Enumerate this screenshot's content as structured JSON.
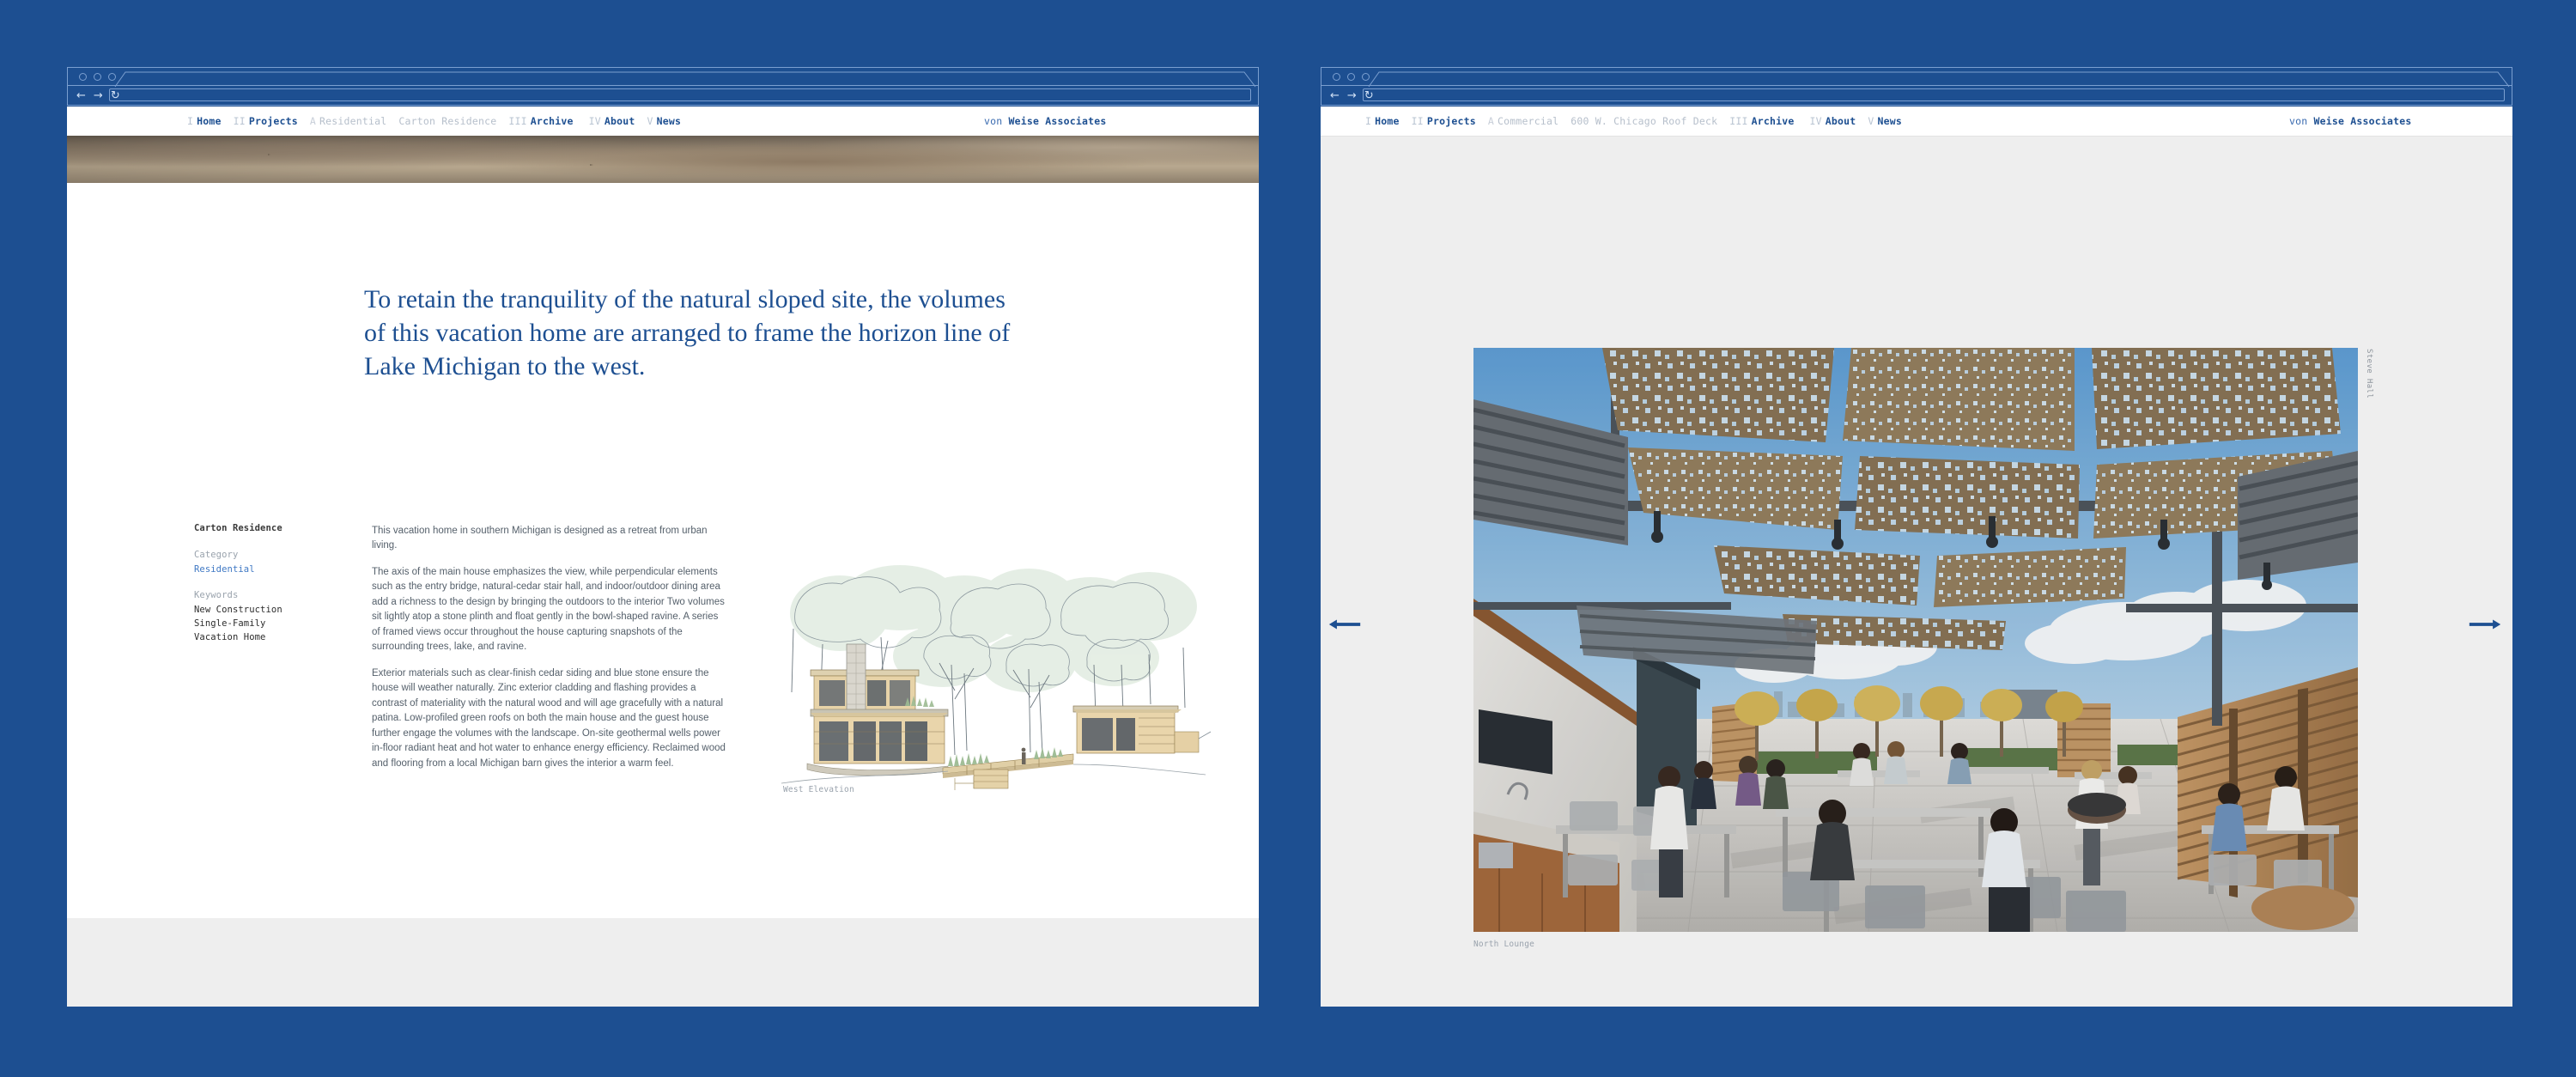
{
  "theme": {
    "page_background": "#1d4f91",
    "chrome_outline": "#7b9fd0",
    "brand_blue": "#1d4f91",
    "link_blue": "#3f78c4",
    "muted_grey": "#b6bfcb",
    "body_grey": "#55606b",
    "panel_grey": "#eeeeee"
  },
  "windows": [
    {
      "id": "left-window",
      "chrome": {
        "dots": [
          "close-dot",
          "minimize-dot",
          "maximize-dot"
        ],
        "back_icon": "←",
        "forward_icon": "→",
        "reload_icon": "↻",
        "url_value": "",
        "url_placeholder": "",
        "tab_title": ""
      },
      "nav": {
        "items": [
          {
            "num": "I",
            "label": "Home",
            "active": true,
            "muted": false
          },
          {
            "num": "II",
            "label": "Projects",
            "active": true,
            "muted": false
          },
          {
            "num": "A",
            "label": "Residential",
            "active": false,
            "muted": true
          },
          {
            "num": "",
            "label": "Carton Residence",
            "active": false,
            "muted": true
          },
          {
            "num": "III",
            "label": "Archive",
            "active": true,
            "muted": false
          },
          {
            "num": "IV",
            "label": "About",
            "active": true,
            "muted": false
          },
          {
            "num": "V",
            "label": "News",
            "active": true,
            "muted": false
          }
        ],
        "brand_prefix": "von ",
        "brand_name": "Weise Associates"
      },
      "hero": {
        "alt": "aerial-site-photograph"
      },
      "headline": "To retain the tranquility of the natural sloped site, the volumes of this vacation home are arranged to frame the horizon line of Lake Michigan to the west.",
      "meta": {
        "project_title": "Carton Residence",
        "category_label": "Category",
        "category_value": "Residential",
        "keywords_label": "Keywords",
        "keywords": [
          "New Construction",
          "Single-Family",
          "Vacation Home"
        ]
      },
      "body_paragraphs": [
        "This vacation home in southern Michigan is designed as a retreat from urban living.",
        "The axis of the main house emphasizes the view, while perpendicular elements such as the entry bridge, natural-cedar stair hall, and indoor/outdoor dining area add a richness to the design by bringing the outdoors to the interior Two volumes sit lightly atop a stone plinth and float gently in the bowl-shaped ravine. A series of framed views occur throughout the house capturing snapshots of the surrounding trees, lake, and ravine.",
        "Exterior materials such as clear-finish cedar siding and blue stone ensure the house will weather naturally. Zinc exterior cladding and flashing provides a contrast of materiality with the natural wood and will age gracefully with a natural patina. Low-profiled green roofs on both the main house and the guest house further engage the volumes with the landscape. On-site geothermal wells power in-floor radiant heat and hot water to enhance energy efficiency. Reclaimed wood and flooring from a local Michigan barn gives the interior a warm feel."
      ],
      "illustration": {
        "alt": "west-elevation-watercolor-sketch",
        "caption": "West Elevation"
      }
    },
    {
      "id": "right-window",
      "chrome": {
        "dots": [
          "close-dot",
          "minimize-dot",
          "maximize-dot"
        ],
        "back_icon": "←",
        "forward_icon": "→",
        "reload_icon": "↻",
        "url_value": "",
        "url_placeholder": "",
        "tab_title": ""
      },
      "nav": {
        "items": [
          {
            "num": "I",
            "label": "Home",
            "active": true,
            "muted": false
          },
          {
            "num": "II",
            "label": "Projects",
            "active": true,
            "muted": false
          },
          {
            "num": "A",
            "label": "Commercial",
            "active": false,
            "muted": true
          },
          {
            "num": "",
            "label": "600 W. Chicago Roof Deck",
            "active": false,
            "muted": true
          },
          {
            "num": "III",
            "label": "Archive",
            "active": true,
            "muted": false
          },
          {
            "num": "IV",
            "label": "About",
            "active": true,
            "muted": false
          },
          {
            "num": "V",
            "label": "News",
            "active": true,
            "muted": false
          }
        ],
        "brand_prefix": "von ",
        "brand_name": "Weise Associates"
      },
      "gallery": {
        "prev_icon": "⟵",
        "next_icon": "⟶",
        "photo_alt": "rooftop-lounge-photograph",
        "caption": "North Lounge",
        "photo_credit": "Steve Hall"
      }
    }
  ]
}
